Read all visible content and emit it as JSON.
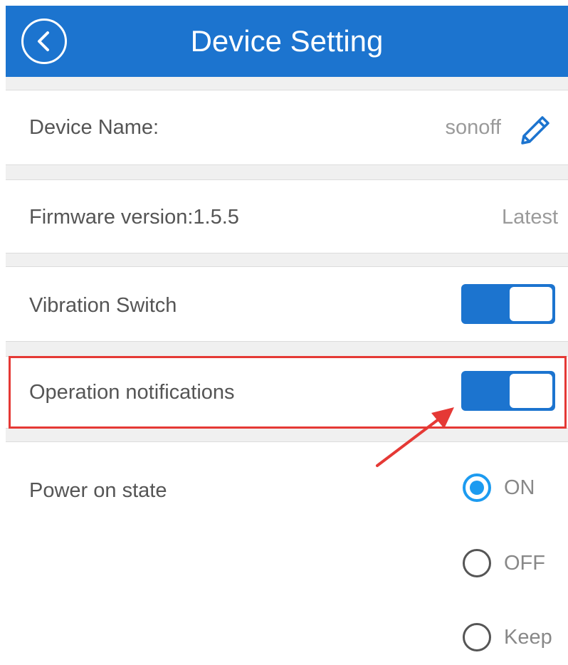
{
  "header": {
    "title": "Device Setting",
    "back_icon": "chevron-left-icon"
  },
  "device_name": {
    "label": "Device Name:",
    "value": "sonoff",
    "edit_icon": "pencil-icon"
  },
  "firmware": {
    "label": "Firmware version:1.5.5",
    "status": "Latest"
  },
  "vibration_switch": {
    "label": "Vibration Switch",
    "enabled": true
  },
  "operation_notifications": {
    "label": "Operation notifications",
    "enabled": true,
    "highlighted": true
  },
  "power_on_state": {
    "label": "Power on state",
    "options": [
      "ON",
      "OFF",
      "Keep"
    ],
    "selected": "ON"
  },
  "colors": {
    "accent": "#1c74cf",
    "radio_selected": "#1c9bf0",
    "highlight": "#e53935"
  }
}
